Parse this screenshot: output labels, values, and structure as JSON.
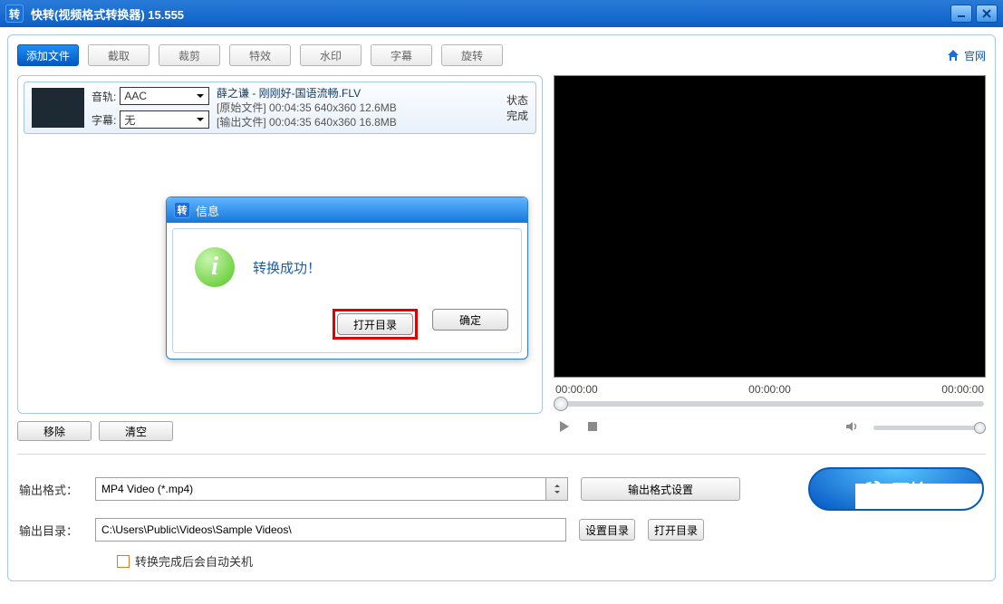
{
  "titlebar": {
    "icon_text": "转",
    "title": "快转(视频格式转换器) 15.555"
  },
  "toolbar": {
    "add_file": "添加文件",
    "cut": "截取",
    "crop": "裁剪",
    "effect": "特效",
    "watermark": "水印",
    "subtitle": "字幕",
    "rotate": "旋转",
    "site_link": "官网"
  },
  "file": {
    "audio_label": "音轨:",
    "audio_value": "AAC",
    "subtitle_label": "字幕:",
    "subtitle_value": "无",
    "name": "薛之谦 - 刚刚好-国语流畅.FLV",
    "src_label": "[原始文件]",
    "src_info": "00:04:35  640x360  12.6MB",
    "out_label": "[输出文件]",
    "out_info": "00:04:35  640x360  16.8MB",
    "status_label": "状态",
    "status_value": "完成"
  },
  "list_btns": {
    "remove": "移除",
    "clear": "清空"
  },
  "preview": {
    "t1": "00:00:00",
    "t2": "00:00:00",
    "t3": "00:00:00"
  },
  "settings": {
    "format_label": "输出格式：",
    "format_value": "MP4 Video (*.mp4)",
    "format_settings_btn": "输出格式设置",
    "dir_label": "输出目录：",
    "dir_value": "C:\\Users\\Public\\Videos\\Sample Videos\\",
    "set_dir_btn": "设置目录",
    "open_dir_btn": "打开目录",
    "start_btn": "开始",
    "shutdown_label": "转换完成后会自动关机"
  },
  "dialog": {
    "icon_text": "转",
    "title": "信息",
    "message": "转换成功！",
    "open_dir": "打开目录",
    "ok": "确定"
  }
}
